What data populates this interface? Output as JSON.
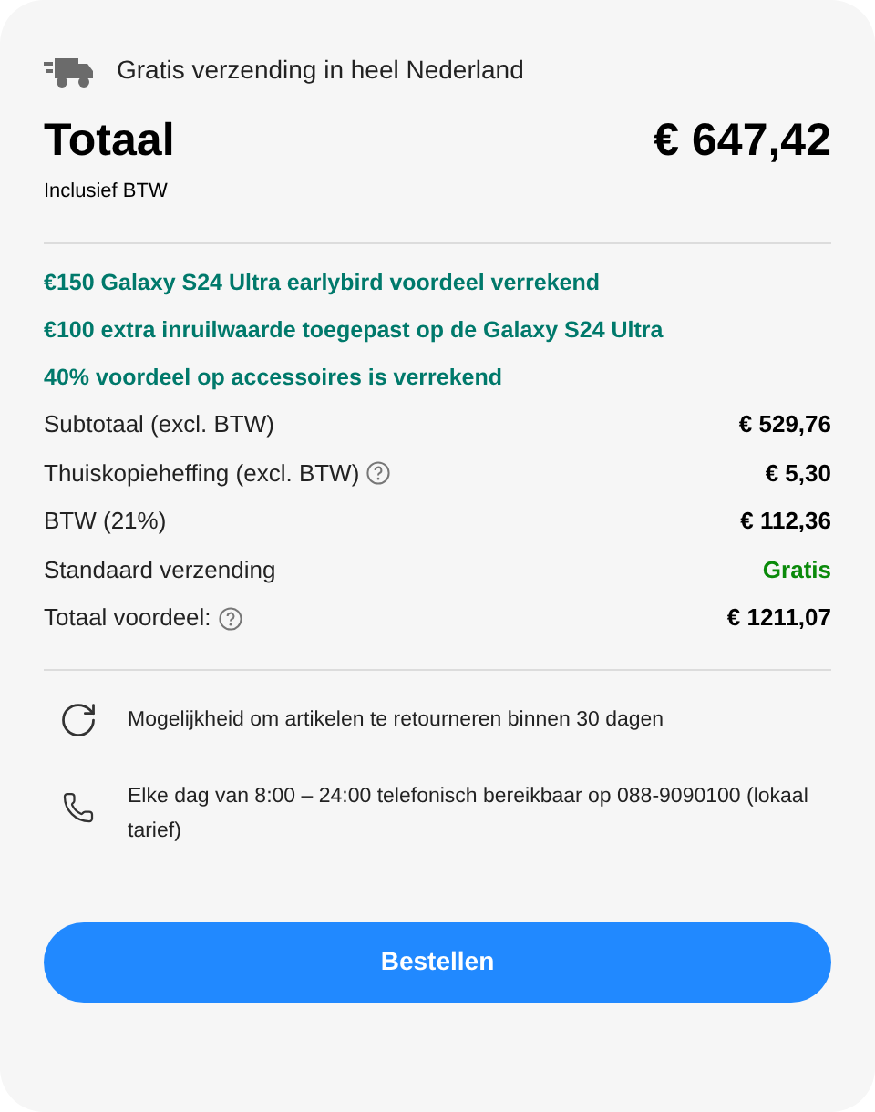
{
  "shipping_banner": "Gratis verzending in heel Nederland",
  "total": {
    "label": "Totaal",
    "amount": "€ 647,42",
    "note": "Inclusief BTW"
  },
  "promotions": [
    "€150 Galaxy S24 Ultra earlybird voordeel verrekend",
    "€100 extra inruilwaarde toegepast op de Galaxy S24 Ultra",
    "40% voordeel op accessoires is verrekend"
  ],
  "lines": [
    {
      "label": "Subtotaal (excl. BTW)",
      "info": false,
      "value": "€ 529,76",
      "kind": "amount"
    },
    {
      "label": "Thuiskopieheffing (excl. BTW)",
      "info": true,
      "value": "€ 5,30",
      "kind": "amount"
    },
    {
      "label": "BTW (21%)",
      "info": false,
      "value": "€ 112,36",
      "kind": "amount"
    },
    {
      "label": "Standaard verzending",
      "info": false,
      "value": "Gratis",
      "kind": "free"
    },
    {
      "label": "Totaal voordeel:",
      "info": true,
      "value": "€ 1211,07",
      "kind": "amount"
    }
  ],
  "services": [
    {
      "kind": "return",
      "text": "Mogelijkheid om artikelen te retourneren binnen 30 dagen"
    },
    {
      "kind": "phone",
      "text": "Elke dag van 8:00 – 24:00 telefonisch bereikbaar op 088-9090100 (lokaal tarief)"
    }
  ],
  "order_button": "Bestellen"
}
